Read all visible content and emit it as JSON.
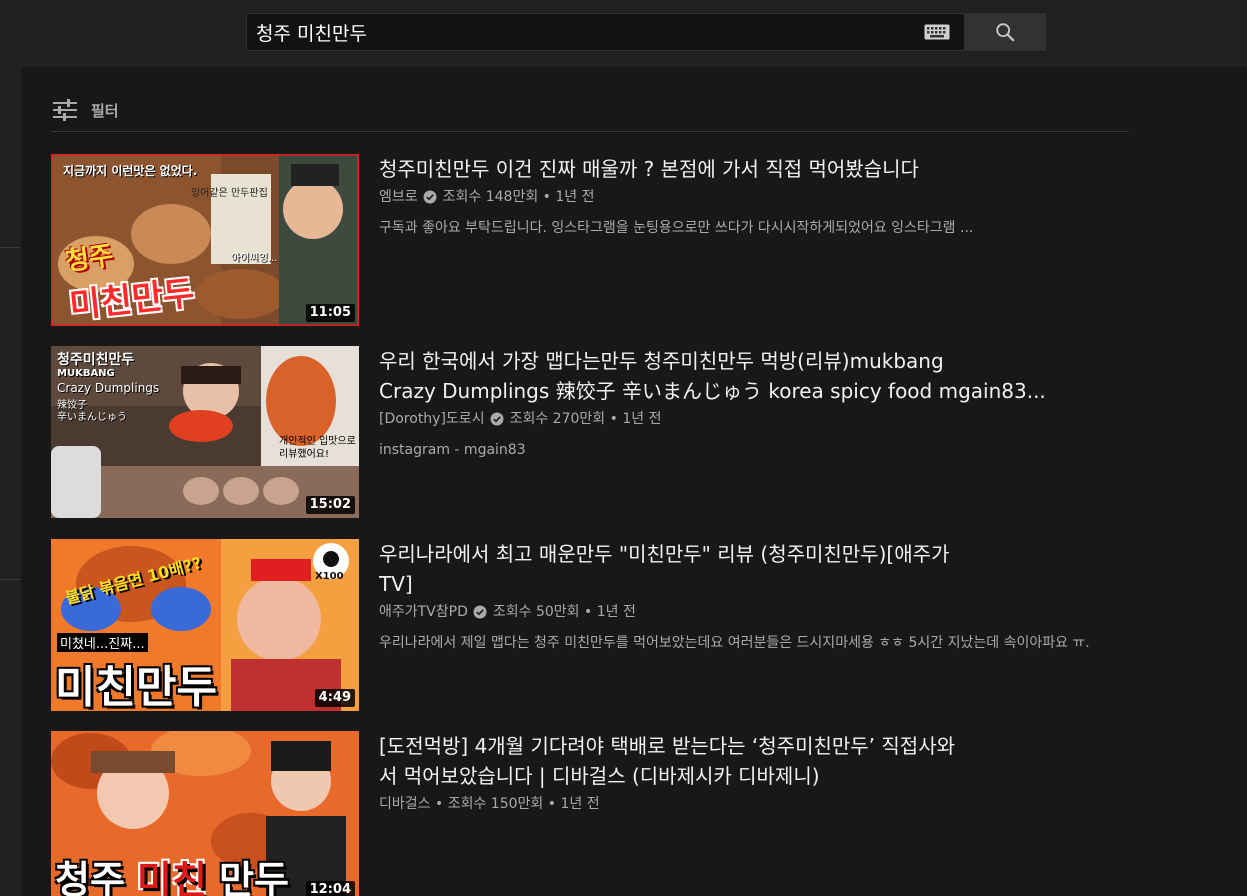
{
  "search": {
    "query": "청주 미친만두"
  },
  "filter": {
    "label": "필터"
  },
  "results": [
    {
      "title": "청주미친만두 이건 진짜 매울까 ? 본점에 가서 직접 먹어봤습니다",
      "channel": "엠브로",
      "views": "조회수 148만회",
      "age": "1년 전",
      "description": "구독과 좋아요 부탁드립니다. 잉스타그램을 눈팅용으로만 쓰다가 다시시작하게되었어요 잉스타그램 ...",
      "duration": "11:05",
      "thumb_text": [
        "청주",
        "미친만두",
        "지금까지 이런맛은 없었다.",
        "잉어같은 만두판집",
        "아이씨잉..."
      ]
    },
    {
      "title": "우리 한국에서 가장 맵다는만두 청주미친만두 먹방(리뷰)mukbang Crazy Dumplings 辣饺子 辛いまんじゅう korea spicy food mgain83...",
      "title_line1": "우리 한국에서 가장 맵다는만두 청주미친만두 먹방(리뷰)mukbang",
      "title_line2": "Crazy Dumplings 辣饺子 辛いまんじゅう korea spicy food mgain83...",
      "channel": "[Dorothy]도로시",
      "views": "조회수 270만회",
      "age": "1년 전",
      "description": "instagram - mgain83",
      "duration": "15:02",
      "thumb_text": [
        "청주미친만두",
        "MUKBANG",
        "Crazy Dumplings",
        "辣饺子",
        "辛いまんじゅう",
        "개인적인 입맛으로",
        "리뷰했어요!"
      ]
    },
    {
      "title_line1": "우리나라에서 최고 매운만두 \"미친만두\" 리뷰 (청주미친만두)[애주가",
      "title_line2": "TV]",
      "channel": "애주가TV참PD",
      "views": "조회수 50만회",
      "age": "1년 전",
      "description": "우리나라에서 제일 맵다는 청주 미친만두를 먹어보았는데요 여러분들은 드시지마세용 ㅎㅎ 5시간 지났는데 속이아파요 ㅠ.",
      "duration": "4:49",
      "thumb_text": [
        "불닭 볶음면 10배??",
        "X100",
        "미쳤네...진짜...",
        "미친만두"
      ]
    },
    {
      "title_line1": "[도전먹방] 4개월 기다려야 택배로 받는다는 ‘청주미친만두’ 직접사와",
      "title_line2": "서 먹어보았습니다 | 디바걸스 (디바제시카 디바제니)",
      "channel": "디바걸스",
      "views": "조회수 150만회",
      "age": "1년 전",
      "description": "",
      "duration": "12:04",
      "thumb_text": [
        "청주",
        "미친",
        "만두"
      ]
    }
  ]
}
